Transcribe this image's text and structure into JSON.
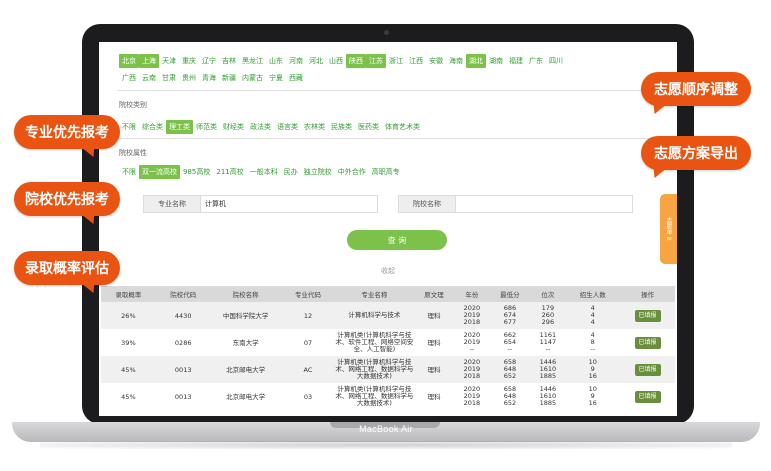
{
  "device": {
    "brand": "MacBook Air"
  },
  "provinces": {
    "row1": [
      {
        "label": "北京",
        "selected": true
      },
      {
        "label": "上海",
        "selected": true
      },
      {
        "label": "天津",
        "selected": false
      },
      {
        "label": "重庆",
        "selected": false
      },
      {
        "label": "辽宁",
        "selected": false
      },
      {
        "label": "吉林",
        "selected": false
      },
      {
        "label": "黑龙江",
        "selected": false
      },
      {
        "label": "山东",
        "selected": false
      },
      {
        "label": "河南",
        "selected": false
      },
      {
        "label": "河北",
        "selected": false
      },
      {
        "label": "山西",
        "selected": false
      },
      {
        "label": "陕西",
        "selected": true
      },
      {
        "label": "江苏",
        "selected": true
      },
      {
        "label": "浙江",
        "selected": false
      },
      {
        "label": "江西",
        "selected": false
      },
      {
        "label": "安徽",
        "selected": false
      },
      {
        "label": "海南",
        "selected": false
      },
      {
        "label": "湖北",
        "selected": true
      },
      {
        "label": "湖南",
        "selected": false
      },
      {
        "label": "福建",
        "selected": false
      },
      {
        "label": "广东",
        "selected": false
      },
      {
        "label": "四川",
        "selected": false
      }
    ],
    "row2": [
      {
        "label": "广西",
        "selected": false
      },
      {
        "label": "云南",
        "selected": false
      },
      {
        "label": "甘肃",
        "selected": false
      },
      {
        "label": "贵州",
        "selected": false
      },
      {
        "label": "青海",
        "selected": false
      },
      {
        "label": "新疆",
        "selected": false
      },
      {
        "label": "内蒙古",
        "selected": false
      },
      {
        "label": "宁夏",
        "selected": false
      },
      {
        "label": "西藏",
        "selected": false
      }
    ]
  },
  "school_category": {
    "label": "院校类别",
    "options": [
      {
        "label": "不限",
        "selected": false
      },
      {
        "label": "综合类",
        "selected": false
      },
      {
        "label": "理工类",
        "selected": true
      },
      {
        "label": "师范类",
        "selected": false
      },
      {
        "label": "财经类",
        "selected": false
      },
      {
        "label": "政法类",
        "selected": false
      },
      {
        "label": "语言类",
        "selected": false
      },
      {
        "label": "农林类",
        "selected": false
      },
      {
        "label": "民族类",
        "selected": false
      },
      {
        "label": "医药类",
        "selected": false
      },
      {
        "label": "体育艺术类",
        "selected": false
      }
    ]
  },
  "school_attr": {
    "label": "院校属性",
    "options": [
      {
        "label": "不限",
        "selected": false
      },
      {
        "label": "双一流高校",
        "selected": true
      },
      {
        "label": "985高校",
        "selected": false
      },
      {
        "label": "211高校",
        "selected": false
      },
      {
        "label": "一般本科",
        "selected": false
      },
      {
        "label": "民办",
        "selected": false
      },
      {
        "label": "独立院校",
        "selected": false
      },
      {
        "label": "中外合作",
        "selected": false
      },
      {
        "label": "高职高专",
        "selected": false
      }
    ]
  },
  "search": {
    "major_label": "专业名称",
    "major_value": "计算机",
    "school_label": "院校名称",
    "school_value": "",
    "query_button": "查 询",
    "collapse_label": "收起"
  },
  "side_tab": "志愿单 8",
  "table": {
    "headers": [
      "录取概率",
      "院校代码",
      "院校名称",
      "专业代码",
      "专业名称",
      "原文理",
      "年份",
      "最低分",
      "位次",
      "招生人数",
      "操作"
    ],
    "rows": [
      {
        "prob": "26%",
        "code": "4430",
        "school": "中国科学院大学",
        "mcode": "12",
        "major": "计算机科学与技术",
        "type": "理科",
        "years": [
          "2020",
          "2019",
          "2018"
        ],
        "scores": [
          "686",
          "674",
          "677"
        ],
        "ranks": [
          "179",
          "260",
          "296"
        ],
        "counts": [
          "4",
          "4",
          "4"
        ],
        "action": "已填报"
      },
      {
        "prob": "39%",
        "code": "0286",
        "school": "东南大学",
        "mcode": "07",
        "major": "计算机类(计算机科学与技术、软件工程、网络空间安全、人工智能)",
        "type": "理科",
        "years": [
          "2020",
          "2019",
          "--"
        ],
        "scores": [
          "662",
          "654",
          "--"
        ],
        "ranks": [
          "1161",
          "1147",
          "--"
        ],
        "counts": [
          "4",
          "8",
          "--"
        ],
        "action": "已填报"
      },
      {
        "prob": "45%",
        "code": "0013",
        "school": "北京邮电大学",
        "mcode": "AC",
        "major": "计算机类(计算机科学与技术、网络工程、数据科学与大数据技术)",
        "type": "理科",
        "years": [
          "2020",
          "2019",
          "2018"
        ],
        "scores": [
          "658",
          "648",
          "652"
        ],
        "ranks": [
          "1446",
          "1610",
          "1885"
        ],
        "counts": [
          "10",
          "9",
          "16"
        ],
        "action": "已填报"
      },
      {
        "prob": "45%",
        "code": "0013",
        "school": "北京邮电大学",
        "mcode": "03",
        "major": "计算机类(计算机科学与技术、网络工程、数据科学与大数据技术)",
        "type": "理科",
        "years": [
          "2020",
          "2019",
          "2018"
        ],
        "scores": [
          "658",
          "648",
          "652"
        ],
        "ranks": [
          "1446",
          "1610",
          "1885"
        ],
        "counts": [
          "10",
          "9",
          "16"
        ],
        "action": "已填报"
      }
    ]
  },
  "callouts": {
    "major_first": "专业优先报考",
    "school_first": "院校优先报考",
    "admission_eval": "录取概率评估",
    "order_adjust": "志愿顺序调整",
    "plan_export": "志愿方案导出"
  },
  "colors": {
    "accent_green": "#7cc24a",
    "callout_orange": "#ea5413",
    "tab_orange": "#f7a541"
  }
}
